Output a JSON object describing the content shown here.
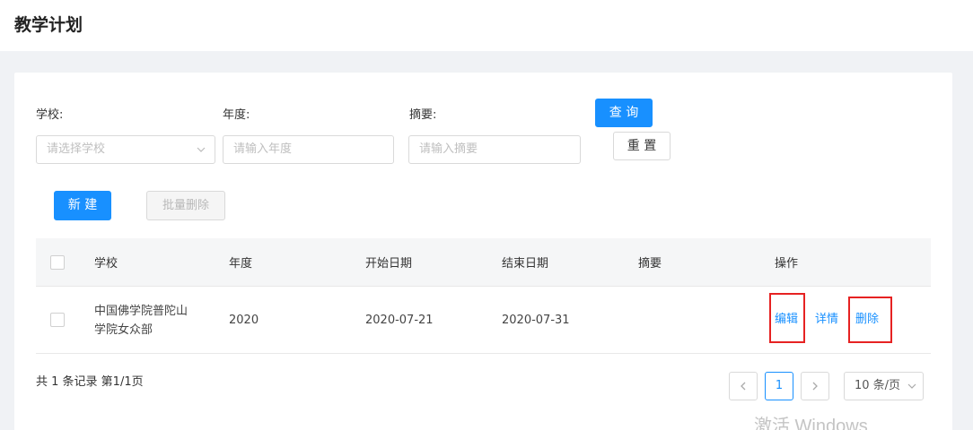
{
  "page": {
    "title": "教学计划"
  },
  "filters": {
    "school_label": "学校:",
    "school_placeholder": "请选择学校",
    "year_label": "年度:",
    "year_placeholder": "请输入年度",
    "summary_label": "摘要:",
    "summary_placeholder": "请输入摘要",
    "query_button": "查 询",
    "reset_button": "重 置"
  },
  "toolbar": {
    "new_button": "新 建",
    "batch_delete_button": "批量删除"
  },
  "table": {
    "columns": [
      "学校",
      "年度",
      "开始日期",
      "结束日期",
      "摘要",
      "操作"
    ],
    "rows": [
      {
        "school_line1": "中国佛学院普陀山",
        "school_line2": "学院女众部",
        "year": "2020",
        "start_date": "2020-07-21",
        "end_date": "2020-07-31",
        "summary": "",
        "actions": {
          "edit": "编辑",
          "detail": "详情",
          "delete": "删除"
        }
      }
    ]
  },
  "pagination": {
    "summary": "共 1 条记录 第1/1页",
    "current_page": "1",
    "page_size": "10 条/页"
  },
  "watermark": "激活 Windows",
  "colors": {
    "accent": "#1890ff",
    "highlight": "#e62222"
  }
}
